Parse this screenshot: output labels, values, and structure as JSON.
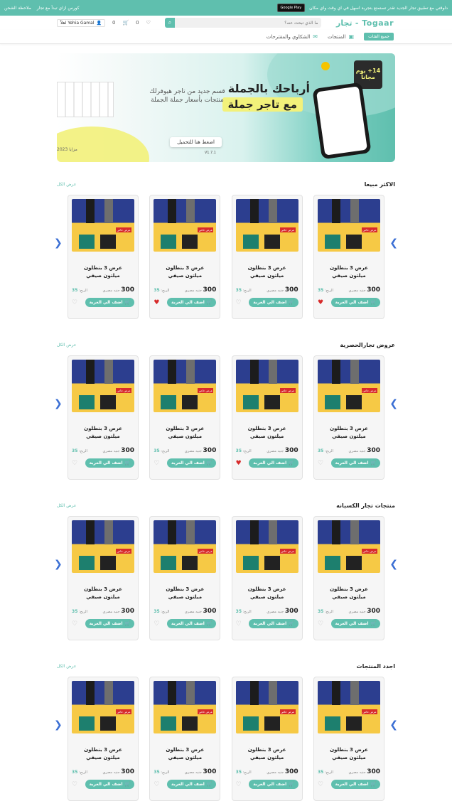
{
  "promo": {
    "text": "دلوقتي مع تطبيق تجار الجديد تقدر تستمتع بتجربة اسهل في اي وقت واي مكان",
    "store": "Google Play",
    "course": "كورس ازاي تبدأ مع تجار",
    "notes": "ملاحظة الشحن"
  },
  "header": {
    "brand": "Togaar - تجار",
    "search_placeholder": "ما الذي تبحث عنه؟",
    "cart_count": "0",
    "wish_count": "0",
    "user": "Yehia Gamal اهلاً"
  },
  "nav": {
    "categories": "جميع الفئات",
    "products": "المنتجات",
    "complaints": "الشكاوي والمقترحات"
  },
  "banner": {
    "headline1": "أرباحك بالجملة",
    "headline2": "مع تاجر جملة",
    "subtitle": "قسم جديد من تاجر هيوفرلك منتجات بأسعار جملة الجملة",
    "cta": "اضغط هنا للتحميل",
    "version": "V1.7.1",
    "badge": "14+ يوم مجاناً",
    "left_tag": "مزايا 2023"
  },
  "sections": [
    {
      "title": "الاكثر مبيعا",
      "view_all": "عرض الكل",
      "products": [
        {
          "name": "عرض 3 بنطلون ميلتون صيفي",
          "price": "300",
          "currency": "جنيه مصري",
          "profit_label": "الربح:",
          "profit": "35",
          "add": "اضف الي العربة",
          "fav": true
        },
        {
          "name": "عرض 3 بنطلون ميلتون صيفي",
          "price": "300",
          "currency": "جنيه مصري",
          "profit_label": "الربح:",
          "profit": "35",
          "add": "اضف الي العربة",
          "fav": false
        },
        {
          "name": "عرض 3 بنطلون ميلتون صيفي",
          "price": "300",
          "currency": "جنيه مصري",
          "profit_label": "الربح:",
          "profit": "35",
          "add": "اضف الي العربة",
          "fav": true
        },
        {
          "name": "عرض 3 بنطلون ميلتون صيفي",
          "price": "300",
          "currency": "جنيه مصري",
          "profit_label": "الربح:",
          "profit": "35",
          "add": "اضف الي العربة",
          "fav": false
        }
      ]
    },
    {
      "title": "عروض تجارالحصرية",
      "view_all": "عرض الكل",
      "products": [
        {
          "name": "عرض 3 بنطلون ميلتون صيفي",
          "price": "300",
          "currency": "جنيه مصري",
          "profit_label": "الربح:",
          "profit": "35",
          "add": "اضف الي العربة",
          "fav": false
        },
        {
          "name": "عرض 3 بنطلون ميلتون صيفي",
          "price": "300",
          "currency": "جنيه مصري",
          "profit_label": "الربح:",
          "profit": "35",
          "add": "اضف الي العربة",
          "fav": true
        },
        {
          "name": "عرض 3 بنطلون ميلتون صيفي",
          "price": "300",
          "currency": "جنيه مصري",
          "profit_label": "الربح:",
          "profit": "35",
          "add": "اضف الي العربة",
          "fav": false
        },
        {
          "name": "عرض 3 بنطلون ميلتون صيفي",
          "price": "300",
          "currency": "جنيه مصري",
          "profit_label": "الربح:",
          "profit": "35",
          "add": "اضف الي العربة",
          "fav": false
        }
      ]
    },
    {
      "title": "منتجات تجار الكسبانه",
      "view_all": "عرض الكل",
      "products": [
        {
          "name": "عرض 3 بنطلون ميلتون صيفي",
          "price": "300",
          "currency": "جنيه مصري",
          "profit_label": "الربح:",
          "profit": "35",
          "add": "اضف الي العربة",
          "fav": false
        },
        {
          "name": "عرض 3 بنطلون ميلتون صيفي",
          "price": "300",
          "currency": "جنيه مصري",
          "profit_label": "الربح:",
          "profit": "35",
          "add": "اضف الي العربة",
          "fav": false
        },
        {
          "name": "عرض 3 بنطلون ميلتون صيفي",
          "price": "300",
          "currency": "جنيه مصري",
          "profit_label": "الربح:",
          "profit": "35",
          "add": "اضف الي العربة",
          "fav": false
        },
        {
          "name": "عرض 3 بنطلون ميلتون صيفي",
          "price": "300",
          "currency": "جنيه مصري",
          "profit_label": "الربح:",
          "profit": "35",
          "add": "اضف الي العربة",
          "fav": false
        }
      ]
    },
    {
      "title": "اجدد المنتجات",
      "view_all": "عرض الكل",
      "products": [
        {
          "name": "عرض 3 بنطلون ميلتون صيفي",
          "price": "300",
          "currency": "جنيه مصري",
          "profit_label": "الربح:",
          "profit": "35",
          "add": "اضف الي العربة",
          "fav": false
        },
        {
          "name": "عرض 3 بنطلون ميلتون صيفي",
          "price": "300",
          "currency": "جنيه مصري",
          "profit_label": "الربح:",
          "profit": "35",
          "add": "اضف الي العربة",
          "fav": false
        },
        {
          "name": "عرض 3 بنطلون ميلتون صيفي",
          "price": "300",
          "currency": "جنيه مصري",
          "profit_label": "الربح:",
          "profit": "35",
          "add": "اضف الي العربة",
          "fav": false
        },
        {
          "name": "عرض 3 بنطلون ميلتون صيفي",
          "price": "300",
          "currency": "جنيه مصري",
          "profit_label": "الربح:",
          "profit": "35",
          "add": "اضف الي العربة",
          "fav": false
        }
      ]
    }
  ],
  "product_image_tag": "عرض خاص",
  "colors": {
    "accent": "#5fbfae",
    "heart_active": "#d72b2b",
    "arrow": "#3b6fd4"
  }
}
